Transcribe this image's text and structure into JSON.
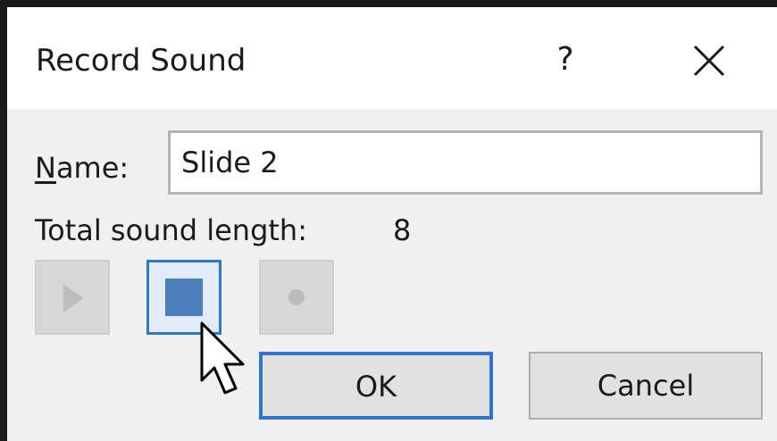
{
  "dialog": {
    "title": "Record Sound",
    "help_glyph": "?",
    "close_glyph": "×"
  },
  "form": {
    "name_label_mnemonic": "N",
    "name_label_rest": "ame:",
    "name_value": "Slide 2",
    "length_label": "Total sound length:",
    "length_value": "8"
  },
  "media_controls": {
    "play": {
      "icon": "play-icon",
      "enabled": false
    },
    "stop": {
      "icon": "stop-icon",
      "enabled": true,
      "focused": true
    },
    "record": {
      "icon": "record-icon",
      "enabled": false
    }
  },
  "buttons": {
    "ok_label": "OK",
    "cancel_label": "Cancel"
  },
  "colors": {
    "accent": "#2e78c9",
    "stop_icon": "#4c7fb9",
    "dialog_bg": "#f0f0f0"
  }
}
